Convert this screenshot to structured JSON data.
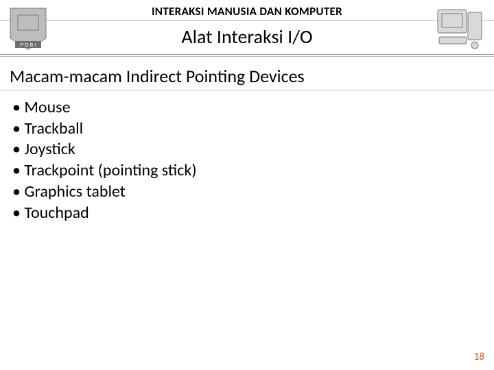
{
  "header": {
    "course": "INTERAKSI MANUSIA DAN KOMPUTER",
    "subtitle": "Alat Interaksi I/O"
  },
  "section_title": "Macam-macam Indirect Pointing Devices",
  "bullets": [
    "Mouse",
    "Trackball",
    "Joystick",
    "Trackpoint (pointing stick)",
    "Graphics tablet",
    "Touchpad"
  ],
  "page_number": "18",
  "icons": {
    "left": "pgri-logo",
    "right": "computer-sketch"
  }
}
